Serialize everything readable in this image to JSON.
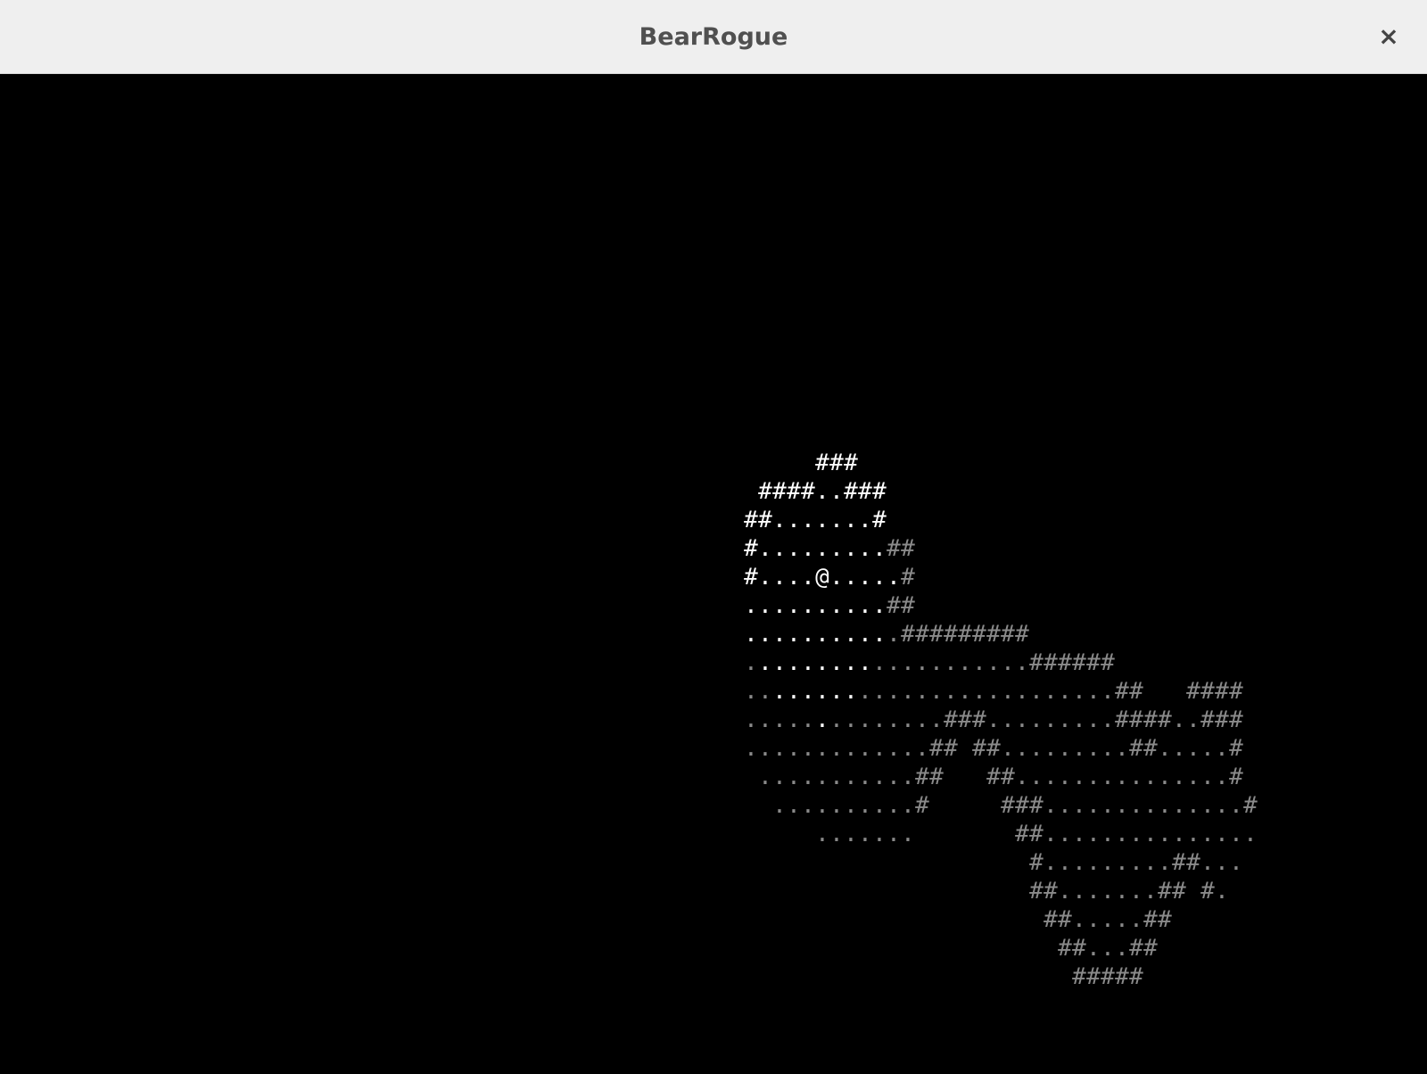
{
  "window": {
    "title": "BearRogue",
    "close_glyph": "×"
  },
  "game": {
    "player_glyph": "@",
    "colors": {
      "background": "#000000",
      "lit": "#ffffff",
      "remembered": "#8a8a8a"
    },
    "map": {
      "rows": [
        {
          "row": 0,
          "text": "     ###"
        },
        {
          "row": 1,
          "text": " ####..###"
        },
        {
          "row": 2,
          "text": "##.......#"
        },
        {
          "row": 3,
          "text": "#.........##"
        },
        {
          "row": 4,
          "text": "#....@.....#"
        },
        {
          "row": 5,
          "text": "..........##"
        },
        {
          "row": 6,
          "text": "...........#########"
        },
        {
          "row": 7,
          "text": "....................######"
        },
        {
          "row": 8,
          "text": "..........................##   ####"
        },
        {
          "row": 9,
          "text": "..............###.........####..###"
        },
        {
          "row": 10,
          "text": ".............## ##.........##.....#"
        },
        {
          "row": 11,
          "text": " ...........##   ##...............#"
        },
        {
          "row": 12,
          "text": "  ..........#     ###..............#"
        },
        {
          "row": 13,
          "text": "     .......       ##..............."
        },
        {
          "row": 14,
          "text": "                    #.........##..."
        },
        {
          "row": 15,
          "text": "                    ##.......## #."
        },
        {
          "row": 16,
          "text": "                     ##.....##"
        },
        {
          "row": 17,
          "text": "                      ##...##"
        },
        {
          "row": 18,
          "text": "                       #####"
        }
      ],
      "lit_spans": [
        {
          "row": 0,
          "from": 5,
          "to": 7
        },
        {
          "row": 1,
          "from": 1,
          "to": 9
        },
        {
          "row": 2,
          "from": 0,
          "to": 9
        },
        {
          "row": 3,
          "from": 0,
          "to": 9
        },
        {
          "row": 4,
          "from": 0,
          "to": 10
        },
        {
          "row": 5,
          "from": 0,
          "to": 9
        },
        {
          "row": 6,
          "from": 0,
          "to": 9
        },
        {
          "row": 7,
          "from": 1,
          "to": 8
        },
        {
          "row": 8,
          "from": 2,
          "to": 7
        },
        {
          "row": 9,
          "from": 5,
          "to": 5
        }
      ]
    }
  }
}
